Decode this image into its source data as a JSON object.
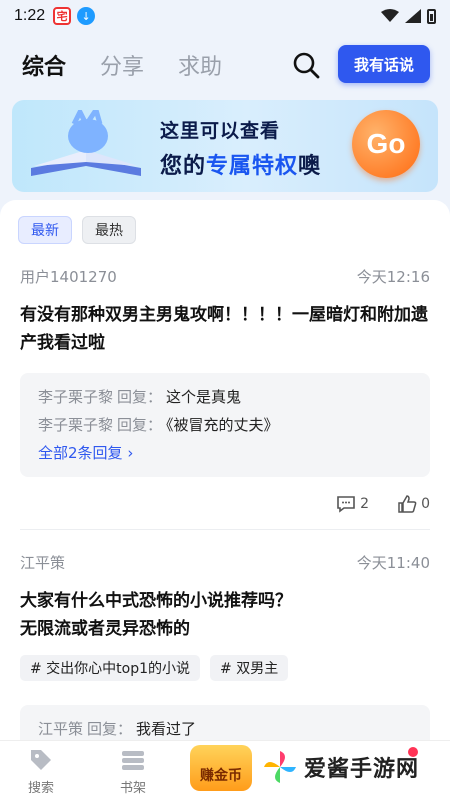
{
  "status": {
    "time": "1:22"
  },
  "nav": {
    "tabs": [
      "综合",
      "分享",
      "求助"
    ],
    "talk_button": "我有话说"
  },
  "banner": {
    "line1": "这里可以查看",
    "line2_prefix": "您的",
    "line2_highlight": "专属特权",
    "line2_suffix": "噢",
    "go": "Go"
  },
  "filters": [
    "最新",
    "最热"
  ],
  "posts": [
    {
      "user": "用户1401270",
      "time": "今天12:16",
      "body": "有没有那种双男主男鬼攻啊！！！！一屋暗灯和附加遗产我看过啦",
      "replies": [
        {
          "name": "李子栗子黎",
          "label": "回复：",
          "text": "这个是真鬼"
        },
        {
          "name": "李子栗子黎",
          "label": "回复：",
          "text": "《被冒充的丈夫》"
        }
      ],
      "more": "全部2条回复",
      "comments": "2",
      "likes": "0"
    },
    {
      "user": "江平策",
      "time": "今天11:40",
      "body_line1": "大家有什么中式恐怖的小说推荐吗？",
      "body_line2": "无限流或者灵异恐怖的",
      "tags": [
        "# 交出你心中top1的小说",
        "# 双男主"
      ],
      "reply": {
        "name": "江平策",
        "label": "回复：",
        "text": "我看过了"
      }
    }
  ],
  "bottom": {
    "search": "搜索",
    "shelf": "书架",
    "earn": "赚金币",
    "watermark": "爱酱手游网"
  },
  "colors": {
    "accent": "#2f58ef",
    "go": "#ff6a10"
  }
}
